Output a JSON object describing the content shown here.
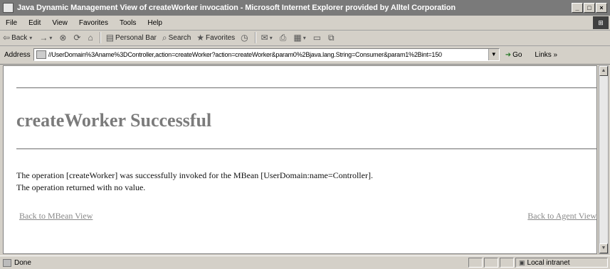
{
  "window": {
    "title": "Java Dynamic Management View of createWorker invocation - Microsoft Internet Explorer provided by Alltel Corporation",
    "minimize": "_",
    "maximize": "□",
    "close": "×"
  },
  "menu": [
    "File",
    "Edit",
    "View",
    "Favorites",
    "Tools",
    "Help"
  ],
  "toolbar": {
    "back": "Back",
    "forward": "→",
    "personal_bar": "Personal Bar",
    "search": "Search",
    "favorites": "Favorites"
  },
  "address": {
    "label": "Address",
    "url": "//UserDomain%3Aname%3DController,action=createWorker?action=createWorker&param0%2Bjava.lang.String=Consumer&param1%2Bint=150",
    "go": "Go",
    "links": "Links"
  },
  "page": {
    "heading": "createWorker Successful",
    "message_line1": "The operation [createWorker] was successfully invoked for the MBean [UserDomain:name=Controller].",
    "message_line2": "The operation returned with no value.",
    "link_mbean": "Back to MBean View",
    "link_agent": "Back to Agent View"
  },
  "status": {
    "text": "Done",
    "zone": "Local intranet"
  }
}
